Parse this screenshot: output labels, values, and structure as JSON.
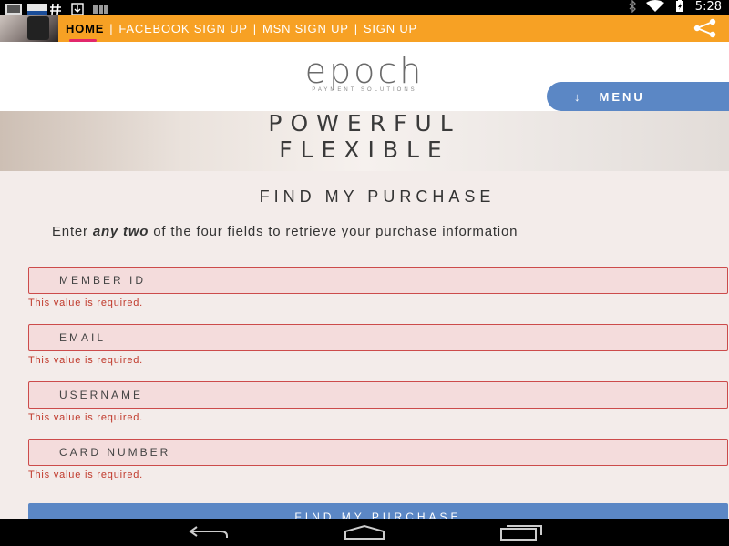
{
  "status_bar": {
    "left_icons": [
      "app-thumbnail-icon",
      "app-thumbnail-icon",
      "hash-icon",
      "download-icon",
      "barcode-icon"
    ],
    "right_icons": [
      "bluetooth-icon",
      "wifi-icon",
      "battery-icon"
    ],
    "time": "5:28"
  },
  "nav": {
    "links": [
      {
        "label": "HOME",
        "active": true
      },
      {
        "label": "FACEBOOK SIGN UP",
        "active": false
      },
      {
        "label": "MSN SIGN UP",
        "active": false
      },
      {
        "label": "SIGN UP",
        "active": false
      }
    ],
    "separator": "|"
  },
  "header": {
    "logo_word": "epoch",
    "logo_sub": "PAYMENT SOLUTIONS",
    "menu_arrow": "↓",
    "menu_label": "MENU"
  },
  "hero": {
    "line1": "POWERFUL",
    "line2": "FLEXIBLE"
  },
  "form": {
    "title": "FIND MY PURCHASE",
    "desc_before": "Enter ",
    "desc_em": "any two",
    "desc_after": " of the four fields to retrieve your purchase information",
    "fields": [
      {
        "placeholder": "MEMBER ID",
        "value": "",
        "error": "This value is required."
      },
      {
        "placeholder": "EMAIL",
        "value": "",
        "error": "This value is required."
      },
      {
        "placeholder": "USERNAME",
        "value": "",
        "error": "This value is required."
      },
      {
        "placeholder": "CARD NUMBER",
        "value": "",
        "error": "This value is required."
      }
    ],
    "submit_label": "FIND MY PURCHASE"
  },
  "colors": {
    "nav_bg": "#f7a124",
    "active_underline": "#e2276c",
    "accent_blue": "#5b87c5",
    "error_red": "#c0392b",
    "field_error_bg": "#f4dcdc"
  }
}
